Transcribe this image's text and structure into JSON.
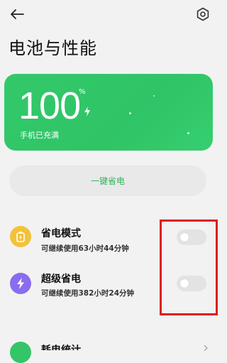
{
  "header": {
    "back_icon": "arrow-left-icon",
    "settings_icon": "gear-icon",
    "title": "电池与性能"
  },
  "battery": {
    "percent": "100",
    "unit": "%",
    "status": "手机已充满",
    "card_color": "#34c568"
  },
  "actions": {
    "one_key_save_label": "一键省电",
    "accent_color": "#2fb35c"
  },
  "modes": [
    {
      "icon": "battery-saver-icon",
      "icon_color": "#f2c23a",
      "title": "省电模式",
      "subtitle": "可继续使用63小时44分钟",
      "enabled": false
    },
    {
      "icon": "lightning-icon",
      "icon_color": "#8a6cf0",
      "title": "超级省电",
      "subtitle": "可继续使用382小时24分钟",
      "enabled": false
    }
  ],
  "next_row": {
    "title": "耗电统计",
    "icon_color": "#34c568"
  },
  "annotation": {
    "highlight_color": "#e0191e"
  }
}
